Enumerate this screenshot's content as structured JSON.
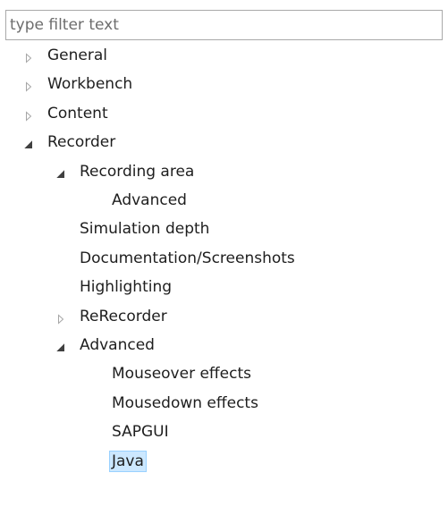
{
  "filter": {
    "placeholder": "type filter text",
    "value": ""
  },
  "tree": [
    {
      "label": "General",
      "level": 0,
      "state": "collapsed"
    },
    {
      "label": "Workbench",
      "level": 0,
      "state": "collapsed"
    },
    {
      "label": "Content",
      "level": 0,
      "state": "collapsed"
    },
    {
      "label": "Recorder",
      "level": 0,
      "state": "expanded"
    },
    {
      "label": "Recording area",
      "level": 1,
      "state": "expanded"
    },
    {
      "label": "Advanced",
      "level": 2,
      "state": "leaf"
    },
    {
      "label": "Simulation depth",
      "level": 1,
      "state": "leaf"
    },
    {
      "label": "Documentation/Screenshots",
      "level": 1,
      "state": "leaf"
    },
    {
      "label": "Highlighting",
      "level": 1,
      "state": "leaf"
    },
    {
      "label": "ReRecorder",
      "level": 1,
      "state": "collapsed"
    },
    {
      "label": "Advanced",
      "level": 1,
      "state": "expanded"
    },
    {
      "label": "Mouseover effects",
      "level": 2,
      "state": "leaf"
    },
    {
      "label": "Mousedown effects",
      "level": 2,
      "state": "leaf"
    },
    {
      "label": "SAPGUI",
      "level": 2,
      "state": "leaf"
    },
    {
      "label": "Java",
      "level": 2,
      "state": "leaf",
      "selected": true
    }
  ],
  "colors": {
    "selection_fill": "#cce8ff",
    "selection_border": "#99d1ff",
    "collapsed_arrow": "#a6a6a6",
    "expanded_arrow": "#404040"
  }
}
